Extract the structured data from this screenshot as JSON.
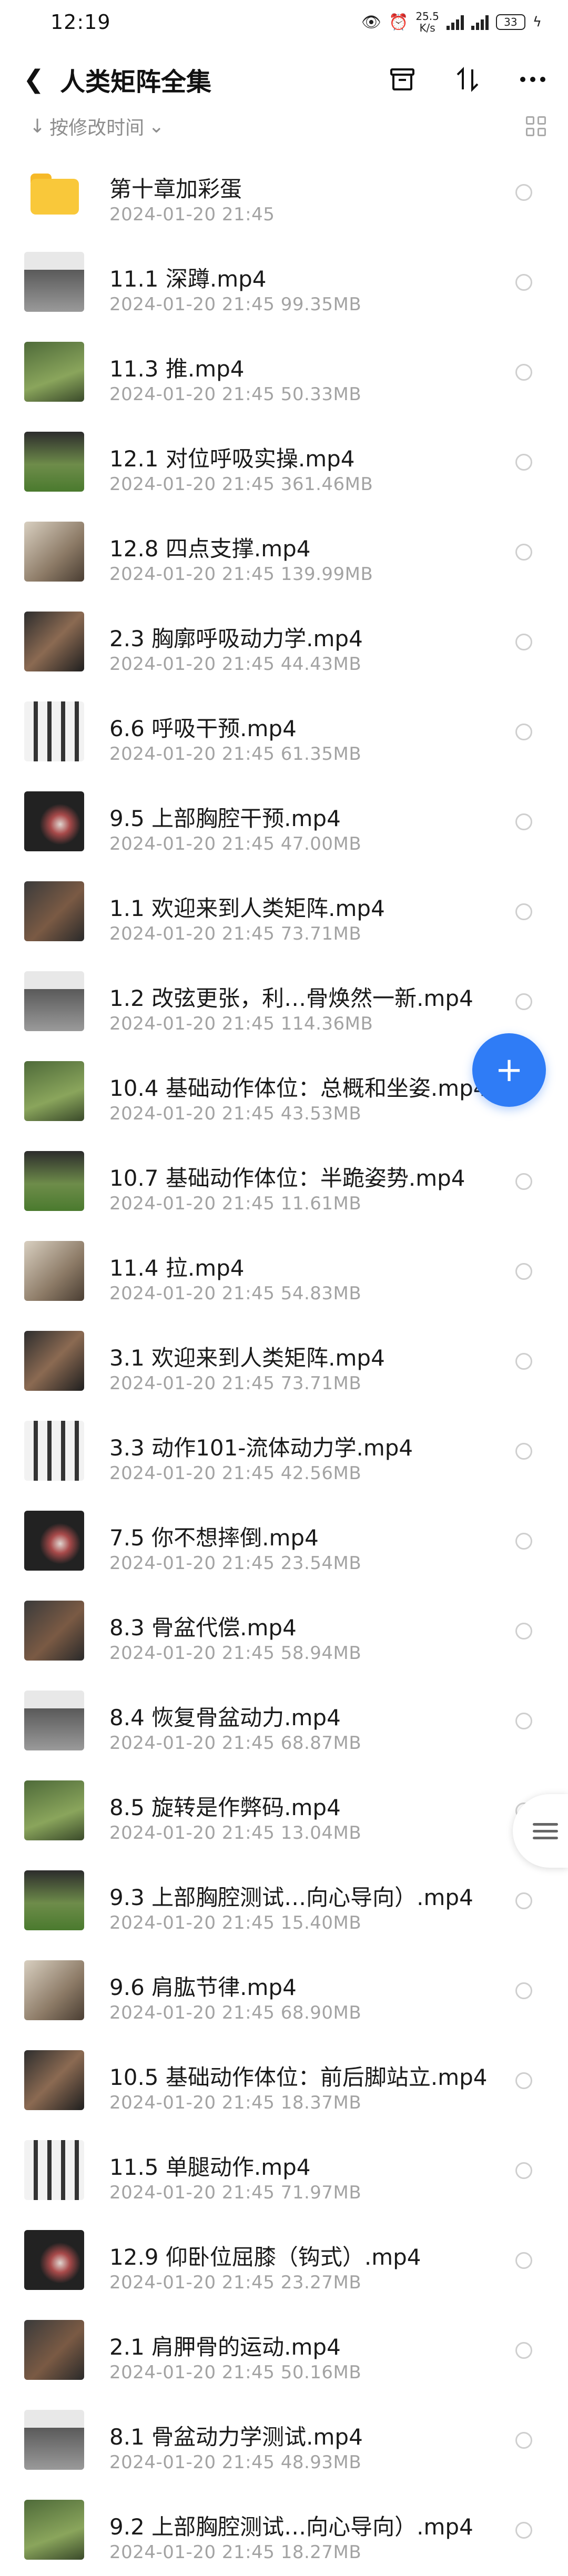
{
  "status_bar": {
    "time": "12:19",
    "speed_value": "25.5",
    "speed_unit": "K/s",
    "battery": "33"
  },
  "header": {
    "title": "人类矩阵全集"
  },
  "sort": {
    "label": "按修改时间"
  },
  "files": [
    {
      "name": "第十章加彩蛋",
      "meta": "2024-01-20  21:45",
      "type": "folder"
    },
    {
      "name": "11.1 深蹲.mp4",
      "meta": "2024-01-20  21:45  99.35MB",
      "type": "video"
    },
    {
      "name": "11.3 推.mp4",
      "meta": "2024-01-20  21:45  50.33MB",
      "type": "video"
    },
    {
      "name": "12.1 对位呼吸实操.mp4",
      "meta": "2024-01-20  21:45  361.46MB",
      "type": "video"
    },
    {
      "name": "12.8 四点支撑.mp4",
      "meta": "2024-01-20  21:45  139.99MB",
      "type": "video"
    },
    {
      "name": "2.3 胸廓呼吸动力学.mp4",
      "meta": "2024-01-20  21:45  44.43MB",
      "type": "video"
    },
    {
      "name": "6.6 呼吸干预.mp4",
      "meta": "2024-01-20  21:45  61.35MB",
      "type": "video"
    },
    {
      "name": "9.5 上部胸腔干预.mp4",
      "meta": "2024-01-20  21:45  47.00MB",
      "type": "video"
    },
    {
      "name": "1.1 欢迎来到人类矩阵.mp4",
      "meta": "2024-01-20  21:45  73.71MB",
      "type": "video"
    },
    {
      "name": "1.2 改弦更张，利…骨焕然一新.mp4",
      "meta": "2024-01-20  21:45  114.36MB",
      "type": "video"
    },
    {
      "name": "10.4 基础动作体位：总概和坐姿.mp4",
      "meta": "2024-01-20  21:45  43.53MB",
      "type": "video"
    },
    {
      "name": "10.7 基础动作体位：半跪姿势.mp4",
      "meta": "2024-01-20  21:45  11.61MB",
      "type": "video"
    },
    {
      "name": "11.4 拉.mp4",
      "meta": "2024-01-20  21:45  54.83MB",
      "type": "video"
    },
    {
      "name": "3.1 欢迎来到人类矩阵.mp4",
      "meta": "2024-01-20  21:45  73.71MB",
      "type": "video"
    },
    {
      "name": "3.3 动作101-流体动力学.mp4",
      "meta": "2024-01-20  21:45  42.56MB",
      "type": "video"
    },
    {
      "name": "7.5 你不想摔倒.mp4",
      "meta": "2024-01-20  21:45  23.54MB",
      "type": "video"
    },
    {
      "name": "8.3 骨盆代偿.mp4",
      "meta": "2024-01-20  21:45  58.94MB",
      "type": "video"
    },
    {
      "name": "8.4 恢复骨盆动力.mp4",
      "meta": "2024-01-20  21:45  68.87MB",
      "type": "video"
    },
    {
      "name": "8.5 旋转是作弊码.mp4",
      "meta": "2024-01-20  21:45  13.04MB",
      "type": "video"
    },
    {
      "name": "9.3 上部胸腔测试…向心导向）.mp4",
      "meta": "2024-01-20  21:45  15.40MB",
      "type": "video"
    },
    {
      "name": "9.6 肩肱节律.mp4",
      "meta": "2024-01-20  21:45  68.90MB",
      "type": "video"
    },
    {
      "name": "10.5 基础动作体位：前后脚站立.mp4",
      "meta": "2024-01-20  21:45  18.37MB",
      "type": "video"
    },
    {
      "name": "11.5 单腿动作.mp4",
      "meta": "2024-01-20  21:45  71.97MB",
      "type": "video"
    },
    {
      "name": "12.9 仰卧位屈膝（钩式）.mp4",
      "meta": "2024-01-20  21:45  23.27MB",
      "type": "video"
    },
    {
      "name": "2.1 肩胛骨的运动.mp4",
      "meta": "2024-01-20  21:45  50.16MB",
      "type": "video"
    },
    {
      "name": "8.1 骨盆动力学测试.mp4",
      "meta": "2024-01-20  21:45  48.93MB",
      "type": "video"
    },
    {
      "name": "9.2 上部胸腔测试…向心导向）.mp4",
      "meta": "2024-01-20  21:45  18.27MB",
      "type": "video"
    }
  ],
  "fab": {
    "icon": "plus-icon"
  },
  "colors": {
    "accent": "#2f7cf6",
    "folder": "#f9c83a",
    "meta_text": "#a3a3a3"
  }
}
